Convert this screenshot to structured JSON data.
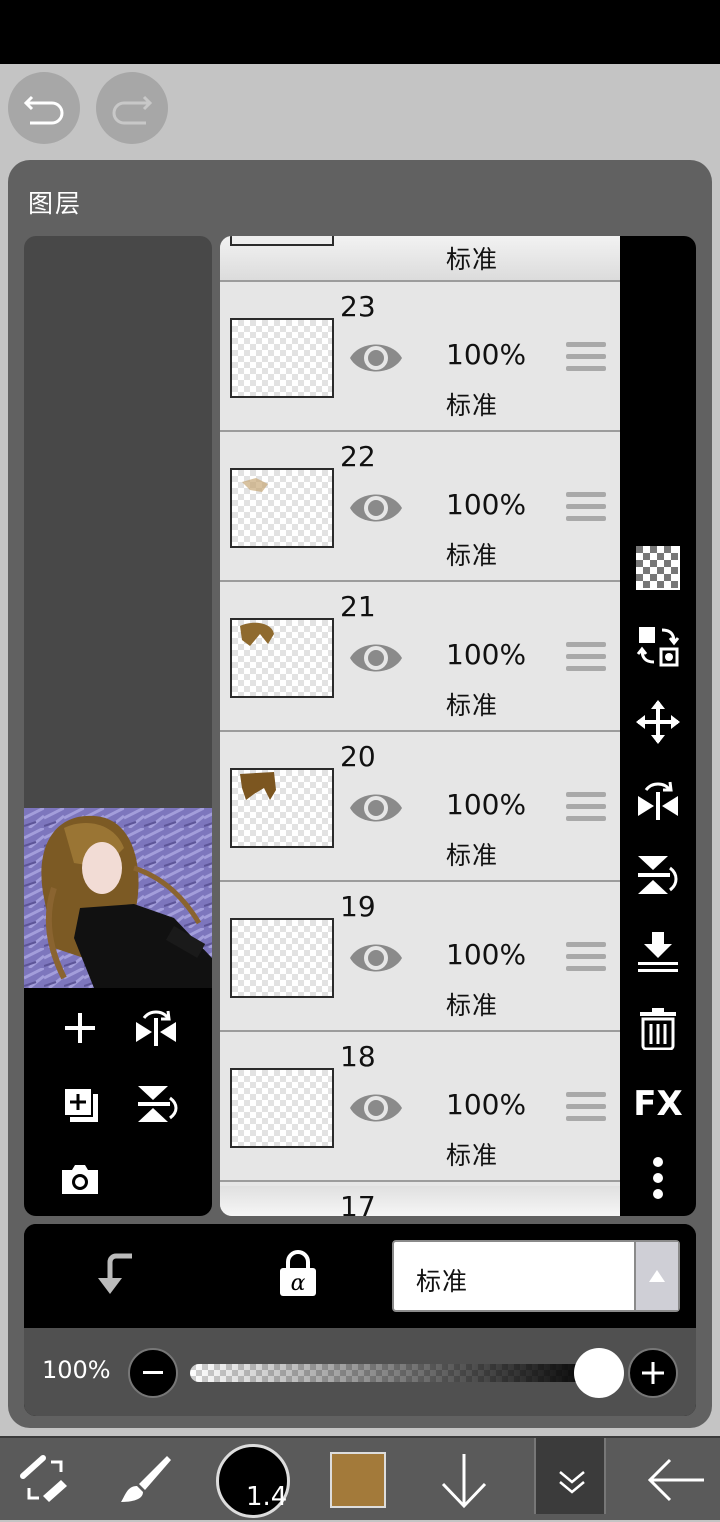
{
  "app": {
    "panel_title": "图层"
  },
  "layers": {
    "partial_top_mode": "标准",
    "rows": [
      {
        "number": "23",
        "opacity": "100%",
        "mode": "标准"
      },
      {
        "number": "22",
        "opacity": "100%",
        "mode": "标准"
      },
      {
        "number": "21",
        "opacity": "100%",
        "mode": "标准"
      },
      {
        "number": "20",
        "opacity": "100%",
        "mode": "标准"
      },
      {
        "number": "19",
        "opacity": "100%",
        "mode": "标准"
      },
      {
        "number": "18",
        "opacity": "100%",
        "mode": "标准"
      }
    ],
    "partial_bottom_number": "17"
  },
  "right_tools": {
    "fx_label": "FX"
  },
  "blend": {
    "selected": "标准"
  },
  "opacity_control": {
    "label": "100%",
    "value": 1.0
  },
  "bottom_toolbar": {
    "brush_size": "1.4",
    "color": "#a37a3a"
  },
  "icons": [
    "undo-icon",
    "redo-icon",
    "add-layer-icon",
    "flip-horizontal-icon",
    "duplicate-layer-icon",
    "flip-vertical-icon",
    "camera-icon",
    "eye-icon",
    "drag-handle-icon",
    "checkerboard-icon",
    "swap-icon",
    "move-icon",
    "delete-icon",
    "more-icon",
    "merge-down-icon",
    "alpha-lock-icon",
    "clipping-icon",
    "brush-icon",
    "transform-icon",
    "back-arrow-icon"
  ]
}
